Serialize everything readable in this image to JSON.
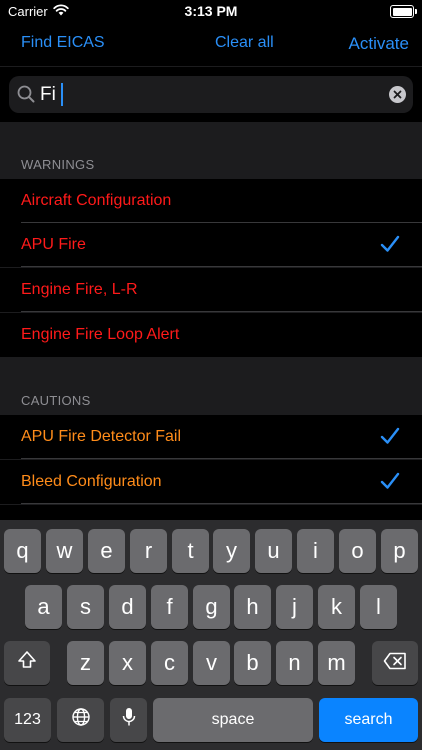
{
  "status_bar": {
    "carrier": "Carrier",
    "time": "3:13 PM"
  },
  "nav": {
    "find": "Find EICAS",
    "clear": "Clear all",
    "activate": "Activate"
  },
  "search": {
    "value": "Fi"
  },
  "sections": [
    {
      "header": "WARNINGS",
      "items": [
        {
          "label": "Aircraft Configuration",
          "checked": false
        },
        {
          "label": "APU Fire",
          "checked": true
        },
        {
          "label": "Engine Fire, L-R",
          "checked": false
        },
        {
          "label": "Engine Fire Loop Alert",
          "checked": false
        }
      ]
    },
    {
      "header": "CAUTIONS",
      "items": [
        {
          "label": "APU Fire Detector Fail",
          "checked": true
        },
        {
          "label": "Bleed Configuration",
          "checked": true
        }
      ]
    }
  ],
  "colors": {
    "accent": "#2a8ff7",
    "warning": "#ff1a1a",
    "caution": "#ff8c1a"
  },
  "keyboard": {
    "row1": [
      "q",
      "w",
      "e",
      "r",
      "t",
      "y",
      "u",
      "i",
      "o",
      "p"
    ],
    "row2": [
      "a",
      "s",
      "d",
      "f",
      "g",
      "h",
      "j",
      "k",
      "l"
    ],
    "row3": [
      "z",
      "x",
      "c",
      "v",
      "b",
      "n",
      "m"
    ],
    "numbers_key": "123",
    "space_key": "space",
    "search_key": "search"
  }
}
